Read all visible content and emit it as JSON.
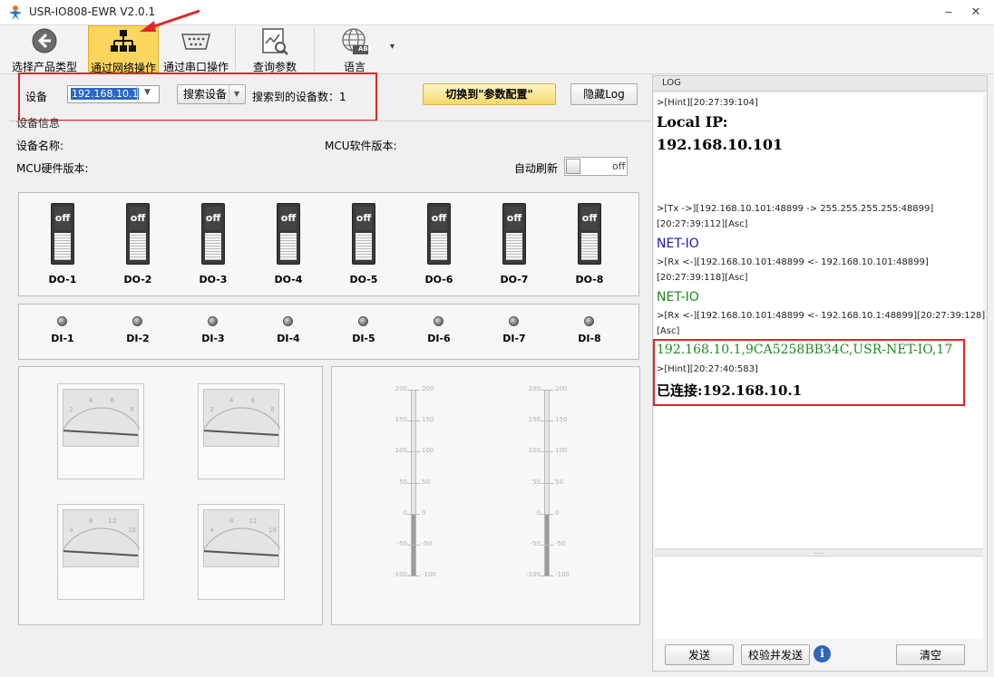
{
  "window": {
    "title": "USR-IO808-EWR V2.0.1",
    "min": "‒",
    "close": "✕"
  },
  "toolbar": {
    "select_product": "选择产品类型",
    "net_op": "通过网络操作",
    "serial_op": "通过串口操作",
    "query_params": "查询参数",
    "language": "语言",
    "lang_badge": "ABC",
    "dropdown_arrow": "▾"
  },
  "connection": {
    "device_label": "设备",
    "ip_value": "192.168.10.1",
    "search_button": "搜索设备",
    "found_label": "搜索到的设备数：",
    "found_count": "1",
    "switch_button": "切换到\"参数配置\"",
    "hide_log": "隐藏Log"
  },
  "device_info": {
    "group_title": "设备信息",
    "name_label": "设备名称:",
    "mcu_sw_label": "MCU软件版本:",
    "mcu_hw_label": "MCU硬件版本:",
    "auto_refresh_label": "自动刷新",
    "auto_refresh_state": "off"
  },
  "outputs": [
    {
      "label": "DO-1",
      "state": "off"
    },
    {
      "label": "DO-2",
      "state": "off"
    },
    {
      "label": "DO-3",
      "state": "off"
    },
    {
      "label": "DO-4",
      "state": "off"
    },
    {
      "label": "DO-5",
      "state": "off"
    },
    {
      "label": "DO-6",
      "state": "off"
    },
    {
      "label": "DO-7",
      "state": "off"
    },
    {
      "label": "DO-8",
      "state": "off"
    }
  ],
  "inputs": [
    {
      "label": "DI-1"
    },
    {
      "label": "DI-2"
    },
    {
      "label": "DI-3"
    },
    {
      "label": "DI-4"
    },
    {
      "label": "DI-5"
    },
    {
      "label": "DI-6"
    },
    {
      "label": "DI-7"
    },
    {
      "label": "DI-8"
    }
  ],
  "meters": [
    {
      "ticks": [
        "0",
        "2",
        "4",
        "6",
        "8",
        "10"
      ],
      "value": 0
    },
    {
      "ticks": [
        "0",
        "2",
        "4",
        "6",
        "8",
        "10"
      ],
      "value": 0
    },
    {
      "ticks": [
        "0",
        "4",
        "8",
        "12",
        "16",
        "20"
      ],
      "value": 0
    },
    {
      "ticks": [
        "0",
        "4",
        "8",
        "12",
        "16",
        "20"
      ],
      "value": 0
    }
  ],
  "thermometers": [
    {
      "ticks": [
        "200",
        "150",
        "100",
        "50",
        "0",
        "-50",
        "-100"
      ],
      "value": 0
    },
    {
      "ticks": [
        "200",
        "150",
        "100",
        "50",
        "0",
        "-50",
        "-100"
      ],
      "value": 0
    }
  ],
  "log": {
    "header": "LOG",
    "l1": ">[Hint][20:27:39:104]",
    "l2": "Local IP:",
    "l3": "192.168.10.101",
    "l4": ">[Tx ->][192.168.10.101:48899 -> 255.255.255.255:48899]",
    "l5": "[20:27:39:112][Asc]",
    "l6": "NET-IO",
    "l7": ">[Rx <-][192.168.10.101:48899 <- 192.168.10.101:48899]",
    "l8": "[20:27:39:118][Asc]",
    "l9": "NET-IO",
    "l10": ">[Rx <-][192.168.10.101:48899 <- 192.168.10.1:48899][20:27:39:128]",
    "l11": "[Asc]",
    "l12": "192.168.10.1,9CA5258BB34C,USR-NET-IO,17",
    "l13": ">[Hint][20:27:40:583]",
    "l14": "已连接:192.168.10.1",
    "splitter": "....",
    "send": "发送",
    "verify_send": "校验并发送",
    "info": "i",
    "clear": "清空",
    "colors": {
      "blue": "#1a1ab8",
      "green": "#1f8a1f"
    }
  }
}
